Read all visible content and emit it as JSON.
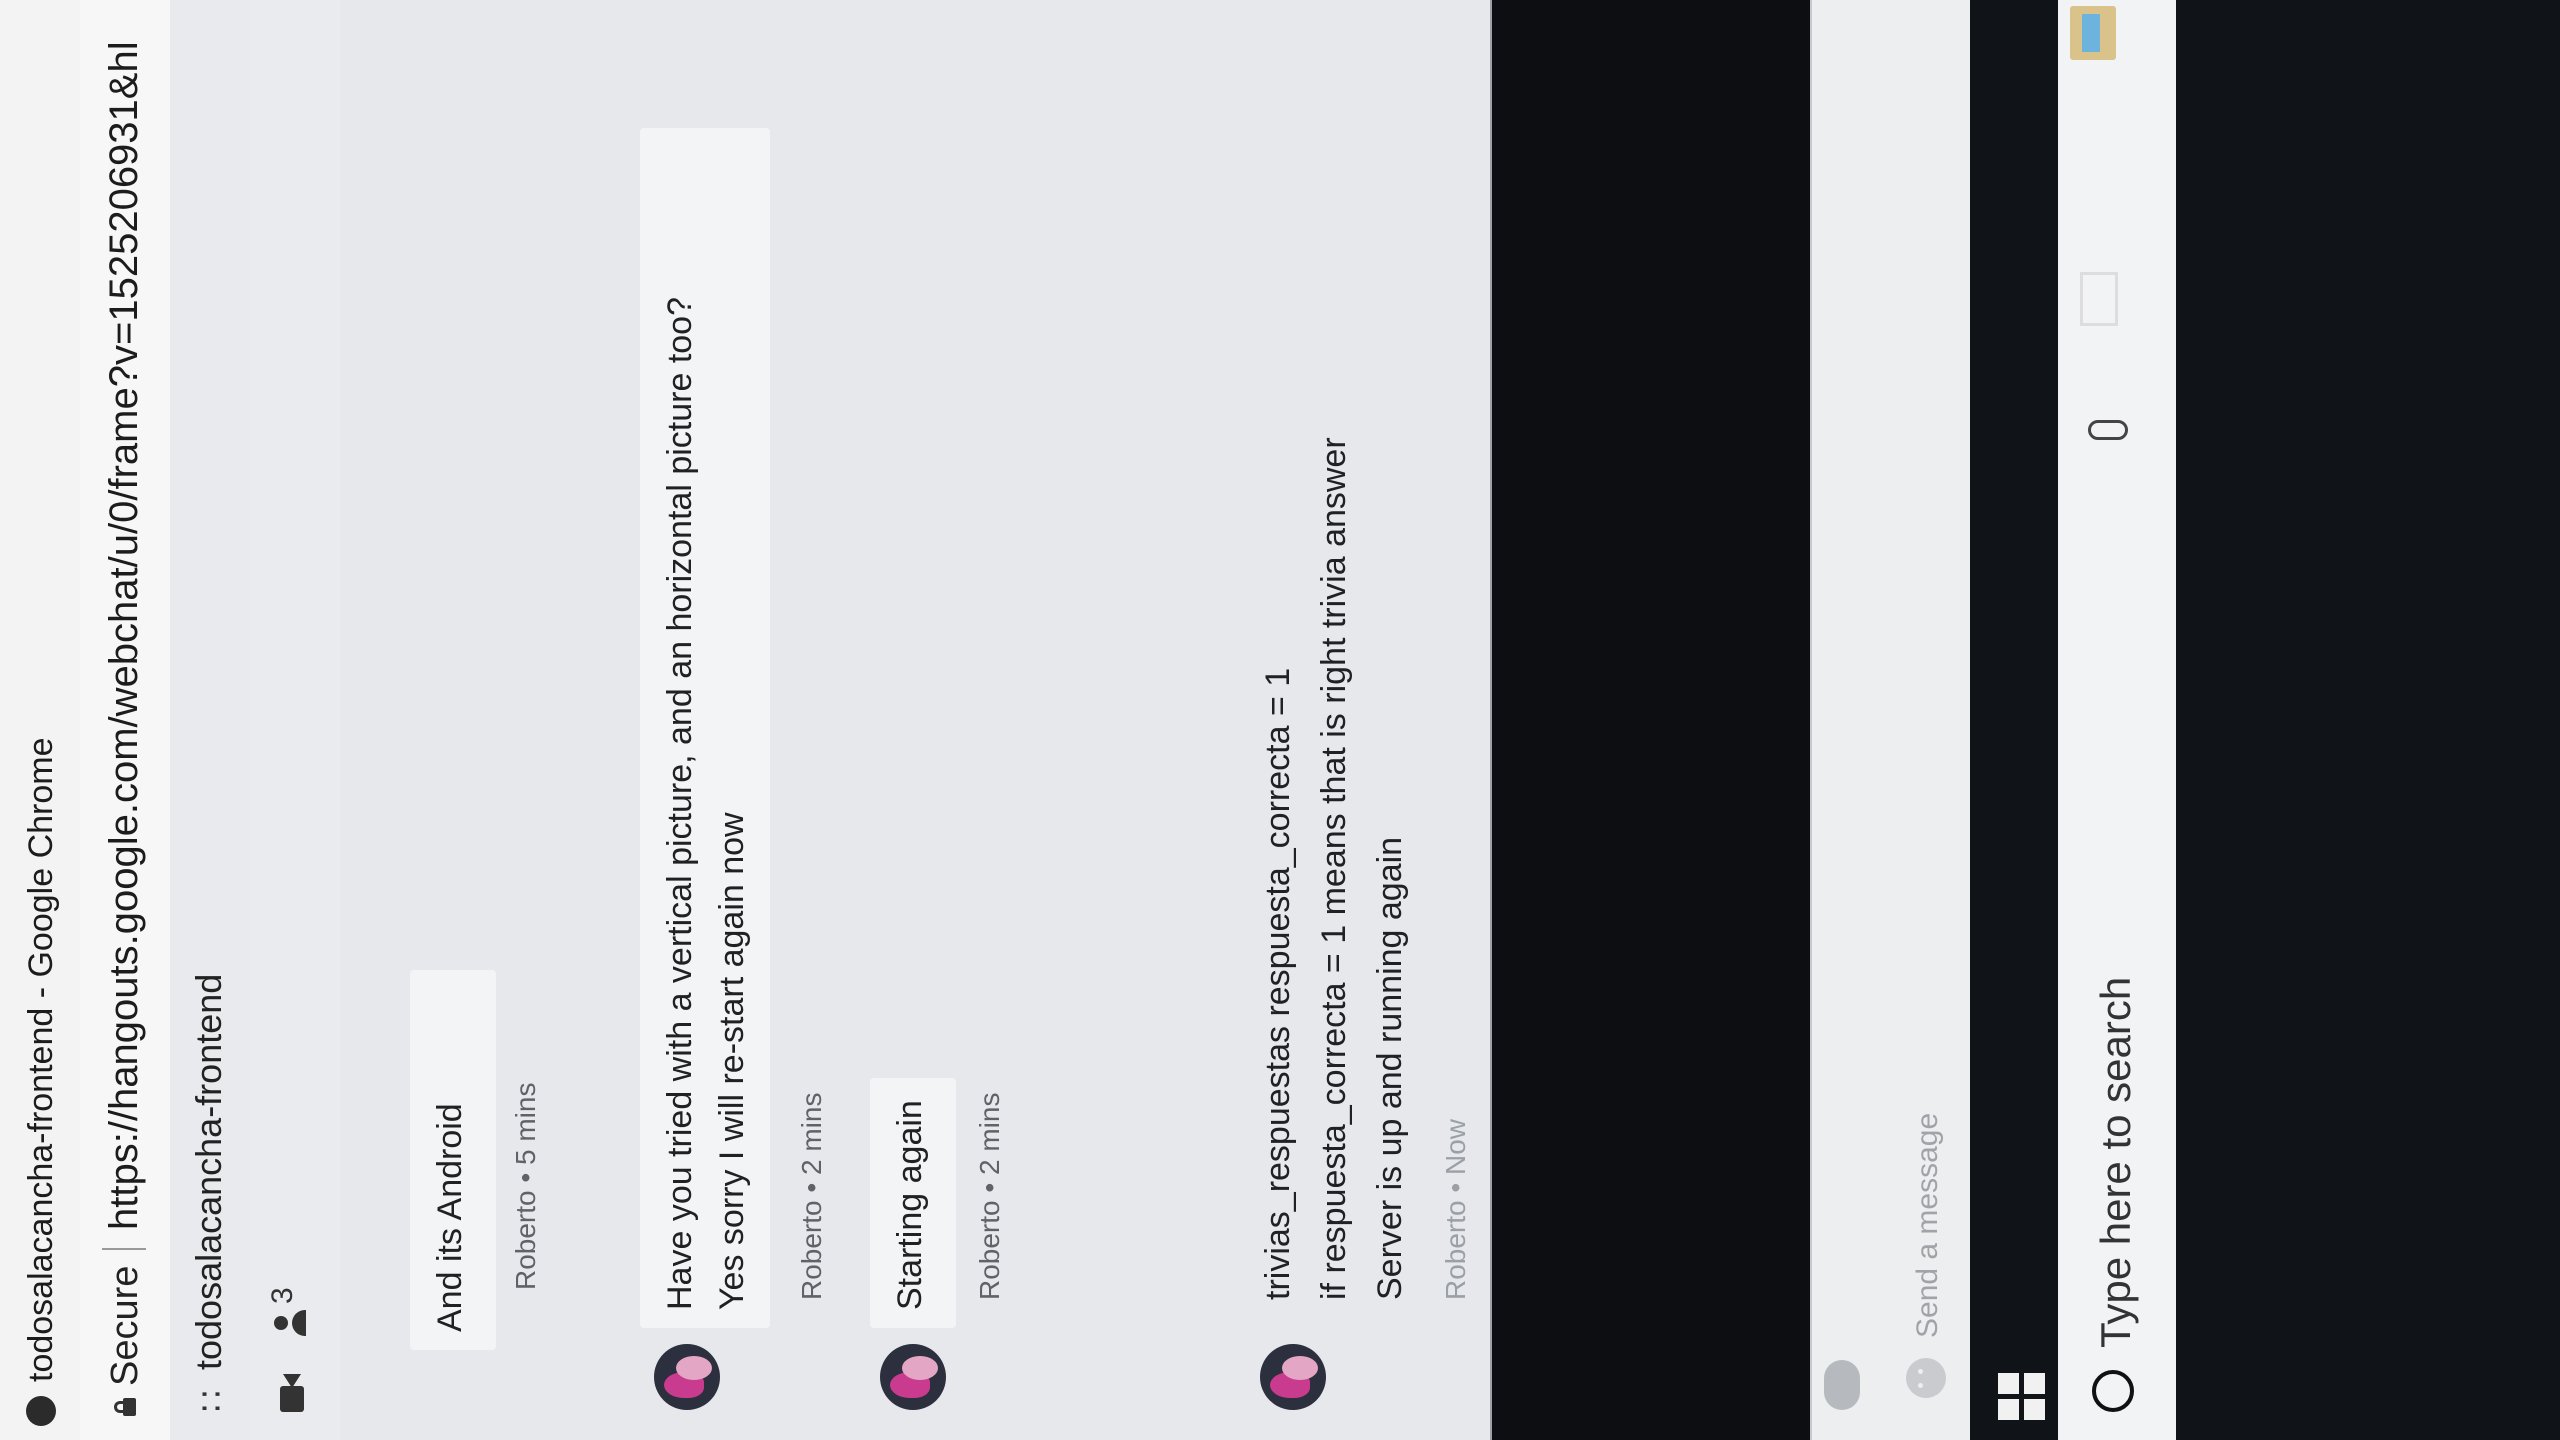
{
  "window": {
    "title": "todosalacancha-frontend - Google Chrome",
    "secure_label": "Secure",
    "url": "https://hangouts.google.com/webchat/u/0/frame?v=1525206931&hl"
  },
  "chat": {
    "title": "todosalacancha-frontend",
    "participant_count": "3"
  },
  "messages": [
    {
      "lines": [
        "And its Android"
      ],
      "meta": "Roberto • 5 mins"
    },
    {
      "lines": [
        "Have you tried with a vertical picture, and an horizontal picture too?",
        "Yes sorry I will re-start again now"
      ],
      "meta": "Roberto • 2 mins"
    },
    {
      "lines": [
        "Starting again"
      ],
      "meta": "Roberto • 2 mins"
    },
    {
      "lines": [
        "trivias_respuestas respuesta_correcta = 1",
        "if respuesta_correcta = 1 means that is right trivia answer",
        "Server is up and running again"
      ],
      "meta": "Roberto • Now"
    }
  ],
  "compose": {
    "placeholder": "Send a message"
  },
  "taskbar": {
    "search_placeholder": "Type here to search"
  },
  "icons": {
    "video": "video-camera-icon",
    "participants": "person-icon",
    "emoji": "emoji-icon",
    "start": "windows-start-icon",
    "search": "cortana-ring-icon",
    "mic": "microphone-icon",
    "task_view": "task-view-icon",
    "explorer": "file-explorer-icon"
  }
}
